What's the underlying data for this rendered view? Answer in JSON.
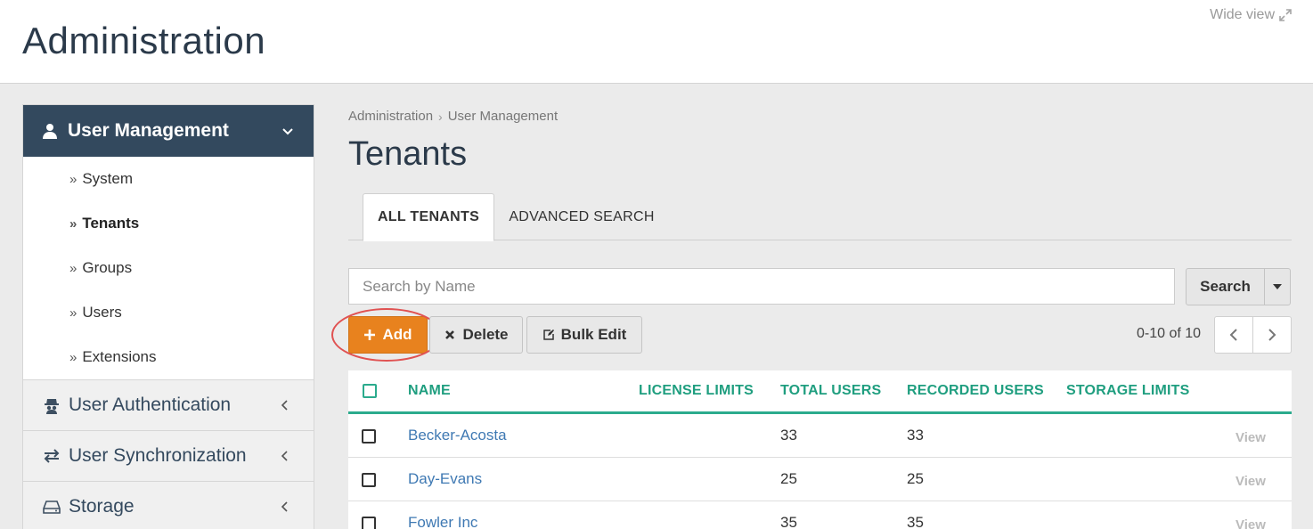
{
  "header": {
    "title": "Administration",
    "wide_view_label": "Wide view"
  },
  "sidebar": {
    "active_section": "User Management",
    "sub_items": [
      {
        "label": "System"
      },
      {
        "label": "Tenants"
      },
      {
        "label": "Groups"
      },
      {
        "label": "Users"
      },
      {
        "label": "Extensions"
      }
    ],
    "groups": [
      {
        "label": "User Authentication",
        "icon": "spy-icon"
      },
      {
        "label": "User Synchronization",
        "icon": "sync-arrows-icon"
      },
      {
        "label": "Storage",
        "icon": "hard-drive-icon"
      }
    ]
  },
  "breadcrumb": [
    "Administration",
    "User Management"
  ],
  "page_title": "Tenants",
  "tabs": [
    {
      "label": "ALL TENANTS",
      "active": true
    },
    {
      "label": "ADVANCED SEARCH",
      "active": false
    }
  ],
  "search": {
    "placeholder": "Search by Name",
    "value": "",
    "button_label": "Search"
  },
  "toolbar": {
    "add_label": "Add",
    "delete_label": "Delete",
    "bulk_edit_label": "Bulk Edit"
  },
  "pagination": {
    "range_text": "0-10 of 10"
  },
  "table": {
    "columns": [
      "NAME",
      "LICENSE LIMITS",
      "TOTAL USERS",
      "RECORDED USERS",
      "STORAGE LIMITS"
    ],
    "view_label": "View",
    "rows": [
      {
        "name": "Becker-Acosta",
        "license_limits": "",
        "total_users": "33",
        "recorded_users": "33",
        "storage_limits": ""
      },
      {
        "name": "Day-Evans",
        "license_limits": "",
        "total_users": "25",
        "recorded_users": "25",
        "storage_limits": ""
      },
      {
        "name": "Fowler Inc",
        "license_limits": "",
        "total_users": "35",
        "recorded_users": "35",
        "storage_limits": ""
      }
    ]
  },
  "colors": {
    "sidebar_header": "#33495e",
    "accent_green": "#2bab8d",
    "add_button": "#e8821e",
    "link_blue": "#3f79b3",
    "highlight_ring": "#e05252"
  }
}
